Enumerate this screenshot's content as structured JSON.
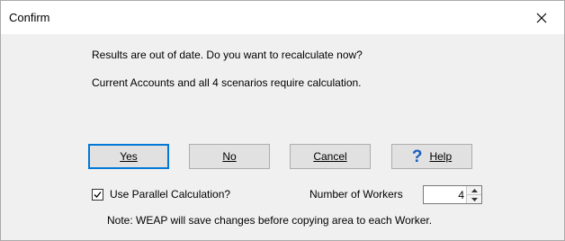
{
  "window": {
    "title": "Confirm",
    "close_icon": "close-icon"
  },
  "message": {
    "line1": "Results are out of date.  Do you want to recalculate now?",
    "line2": "Current Accounts and all 4 scenarios require calculation."
  },
  "buttons": {
    "yes": "Yes",
    "no": "No",
    "cancel": "Cancel",
    "help": "Help",
    "help_icon": "help-question-icon",
    "default_border_color": "#0078d7"
  },
  "options": {
    "parallel_label": "Use Parallel Calculation?",
    "parallel_checked": true,
    "workers_label": "Number of Workers",
    "workers_value": "4"
  },
  "note": "Note: WEAP will save changes before copying area to each Worker."
}
